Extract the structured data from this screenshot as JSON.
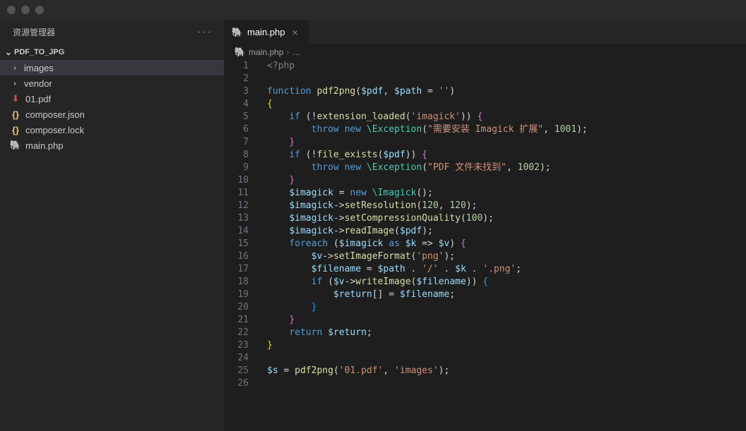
{
  "sidebar": {
    "title": "资源管理器",
    "project": "PDF_TO_JPG",
    "items": [
      {
        "label": "images",
        "type": "folder"
      },
      {
        "label": "vendor",
        "type": "folder"
      },
      {
        "label": "01.pdf",
        "type": "pdf"
      },
      {
        "label": "composer.json",
        "type": "json"
      },
      {
        "label": "composer.lock",
        "type": "json"
      },
      {
        "label": "main.php",
        "type": "php"
      }
    ]
  },
  "tab": {
    "name": "main.php"
  },
  "breadcrumb": {
    "file": "main.php",
    "trail": "…"
  },
  "code": {
    "lines": [
      {
        "n": 1,
        "tokens": [
          [
            "tag",
            "<?php"
          ]
        ]
      },
      {
        "n": 2,
        "tokens": []
      },
      {
        "n": 3,
        "tokens": [
          [
            "kw",
            "function "
          ],
          [
            "fn",
            "pdf2png"
          ],
          [
            "pun",
            "("
          ],
          [
            "var",
            "$pdf"
          ],
          [
            "pun",
            ", "
          ],
          [
            "var",
            "$path"
          ],
          [
            "op",
            " = "
          ],
          [
            "str",
            "''"
          ],
          [
            "pun",
            ")"
          ]
        ]
      },
      {
        "n": 4,
        "tokens": [
          [
            "brace",
            "{"
          ]
        ]
      },
      {
        "n": 5,
        "tokens": [
          [
            "",
            "    "
          ],
          [
            "kw",
            "if"
          ],
          [
            "pun",
            " ("
          ],
          [
            "op",
            "!"
          ],
          [
            "fn",
            "extension_loaded"
          ],
          [
            "pun",
            "("
          ],
          [
            "str",
            "'imagick'"
          ],
          [
            "pun",
            ")) "
          ],
          [
            "brace2",
            "{"
          ]
        ]
      },
      {
        "n": 6,
        "tokens": [
          [
            "",
            "        "
          ],
          [
            "kw",
            "throw"
          ],
          [
            "op",
            " "
          ],
          [
            "kw",
            "new"
          ],
          [
            "op",
            " "
          ],
          [
            "type",
            "\\Exception"
          ],
          [
            "pun",
            "("
          ],
          [
            "str",
            "\"需要安装 Imagick 扩展\""
          ],
          [
            "pun",
            ", "
          ],
          [
            "num",
            "1001"
          ],
          [
            "pun",
            ");"
          ]
        ]
      },
      {
        "n": 7,
        "tokens": [
          [
            "",
            "    "
          ],
          [
            "brace2",
            "}"
          ]
        ]
      },
      {
        "n": 8,
        "tokens": [
          [
            "",
            "    "
          ],
          [
            "kw",
            "if"
          ],
          [
            "pun",
            " ("
          ],
          [
            "op",
            "!"
          ],
          [
            "fn",
            "file_exists"
          ],
          [
            "pun",
            "("
          ],
          [
            "var",
            "$pdf"
          ],
          [
            "pun",
            ")) "
          ],
          [
            "brace2",
            "{"
          ]
        ]
      },
      {
        "n": 9,
        "tokens": [
          [
            "",
            "        "
          ],
          [
            "kw",
            "throw"
          ],
          [
            "op",
            " "
          ],
          [
            "kw",
            "new"
          ],
          [
            "op",
            " "
          ],
          [
            "type",
            "\\Exception"
          ],
          [
            "pun",
            "("
          ],
          [
            "str",
            "\"PDF 文件未找到\""
          ],
          [
            "pun",
            ", "
          ],
          [
            "num",
            "1002"
          ],
          [
            "pun",
            ");"
          ]
        ]
      },
      {
        "n": 10,
        "tokens": [
          [
            "",
            "    "
          ],
          [
            "brace2",
            "}"
          ]
        ]
      },
      {
        "n": 11,
        "tokens": [
          [
            "",
            "    "
          ],
          [
            "var",
            "$imagick"
          ],
          [
            "op",
            " = "
          ],
          [
            "kw",
            "new"
          ],
          [
            "op",
            " "
          ],
          [
            "type",
            "\\Imagick"
          ],
          [
            "pun",
            "();"
          ]
        ]
      },
      {
        "n": 12,
        "tokens": [
          [
            "",
            "    "
          ],
          [
            "var",
            "$imagick"
          ],
          [
            "op",
            "->"
          ],
          [
            "fn",
            "setResolution"
          ],
          [
            "pun",
            "("
          ],
          [
            "num",
            "120"
          ],
          [
            "pun",
            ", "
          ],
          [
            "num",
            "120"
          ],
          [
            "pun",
            ");"
          ]
        ]
      },
      {
        "n": 13,
        "tokens": [
          [
            "",
            "    "
          ],
          [
            "var",
            "$imagick"
          ],
          [
            "op",
            "->"
          ],
          [
            "fn",
            "setCompressionQuality"
          ],
          [
            "pun",
            "("
          ],
          [
            "num",
            "100"
          ],
          [
            "pun",
            ");"
          ]
        ]
      },
      {
        "n": 14,
        "tokens": [
          [
            "",
            "    "
          ],
          [
            "var",
            "$imagick"
          ],
          [
            "op",
            "->"
          ],
          [
            "fn",
            "readImage"
          ],
          [
            "pun",
            "("
          ],
          [
            "var",
            "$pdf"
          ],
          [
            "pun",
            ");"
          ]
        ]
      },
      {
        "n": 15,
        "tokens": [
          [
            "",
            "    "
          ],
          [
            "kw",
            "foreach"
          ],
          [
            "pun",
            " ("
          ],
          [
            "var",
            "$imagick"
          ],
          [
            "op",
            " "
          ],
          [
            "kw",
            "as"
          ],
          [
            "op",
            " "
          ],
          [
            "var",
            "$k"
          ],
          [
            "op",
            " => "
          ],
          [
            "var",
            "$v"
          ],
          [
            "pun",
            ") "
          ],
          [
            "brace2",
            "{"
          ]
        ]
      },
      {
        "n": 16,
        "tokens": [
          [
            "",
            "        "
          ],
          [
            "var",
            "$v"
          ],
          [
            "op",
            "->"
          ],
          [
            "fn",
            "setImageFormat"
          ],
          [
            "pun",
            "("
          ],
          [
            "str",
            "'png'"
          ],
          [
            "pun",
            ");"
          ]
        ]
      },
      {
        "n": 17,
        "tokens": [
          [
            "",
            "        "
          ],
          [
            "var",
            "$filename"
          ],
          [
            "op",
            " = "
          ],
          [
            "var",
            "$path"
          ],
          [
            "op",
            " . "
          ],
          [
            "str",
            "'/'"
          ],
          [
            "op",
            " . "
          ],
          [
            "var",
            "$k"
          ],
          [
            "op",
            " . "
          ],
          [
            "str",
            "'.png'"
          ],
          [
            "pun",
            ";"
          ]
        ]
      },
      {
        "n": 18,
        "tokens": [
          [
            "",
            "        "
          ],
          [
            "kw",
            "if"
          ],
          [
            "pun",
            " ("
          ],
          [
            "var",
            "$v"
          ],
          [
            "op",
            "->"
          ],
          [
            "fn",
            "writeImage"
          ],
          [
            "pun",
            "("
          ],
          [
            "var",
            "$filename"
          ],
          [
            "pun",
            ")) "
          ],
          [
            "brace3",
            "{"
          ]
        ]
      },
      {
        "n": 19,
        "tokens": [
          [
            "",
            "            "
          ],
          [
            "var",
            "$return"
          ],
          [
            "pun",
            "[] "
          ],
          [
            "op",
            "="
          ],
          [
            "op",
            " "
          ],
          [
            "var",
            "$filename"
          ],
          [
            "pun",
            ";"
          ]
        ]
      },
      {
        "n": 20,
        "tokens": [
          [
            "",
            "        "
          ],
          [
            "brace3",
            "}"
          ]
        ]
      },
      {
        "n": 21,
        "tokens": [
          [
            "",
            "    "
          ],
          [
            "brace2",
            "}"
          ]
        ]
      },
      {
        "n": 22,
        "tokens": [
          [
            "",
            "    "
          ],
          [
            "kw",
            "return"
          ],
          [
            "op",
            " "
          ],
          [
            "var",
            "$return"
          ],
          [
            "pun",
            ";"
          ]
        ]
      },
      {
        "n": 23,
        "tokens": [
          [
            "brace",
            "}"
          ]
        ]
      },
      {
        "n": 24,
        "tokens": []
      },
      {
        "n": 25,
        "tokens": [
          [
            "var",
            "$s"
          ],
          [
            "op",
            " = "
          ],
          [
            "fn",
            "pdf2png"
          ],
          [
            "pun",
            "("
          ],
          [
            "str",
            "'01.pdf'"
          ],
          [
            "pun",
            ", "
          ],
          [
            "str",
            "'images'"
          ],
          [
            "pun",
            ");"
          ]
        ]
      },
      {
        "n": 26,
        "tokens": []
      }
    ]
  }
}
